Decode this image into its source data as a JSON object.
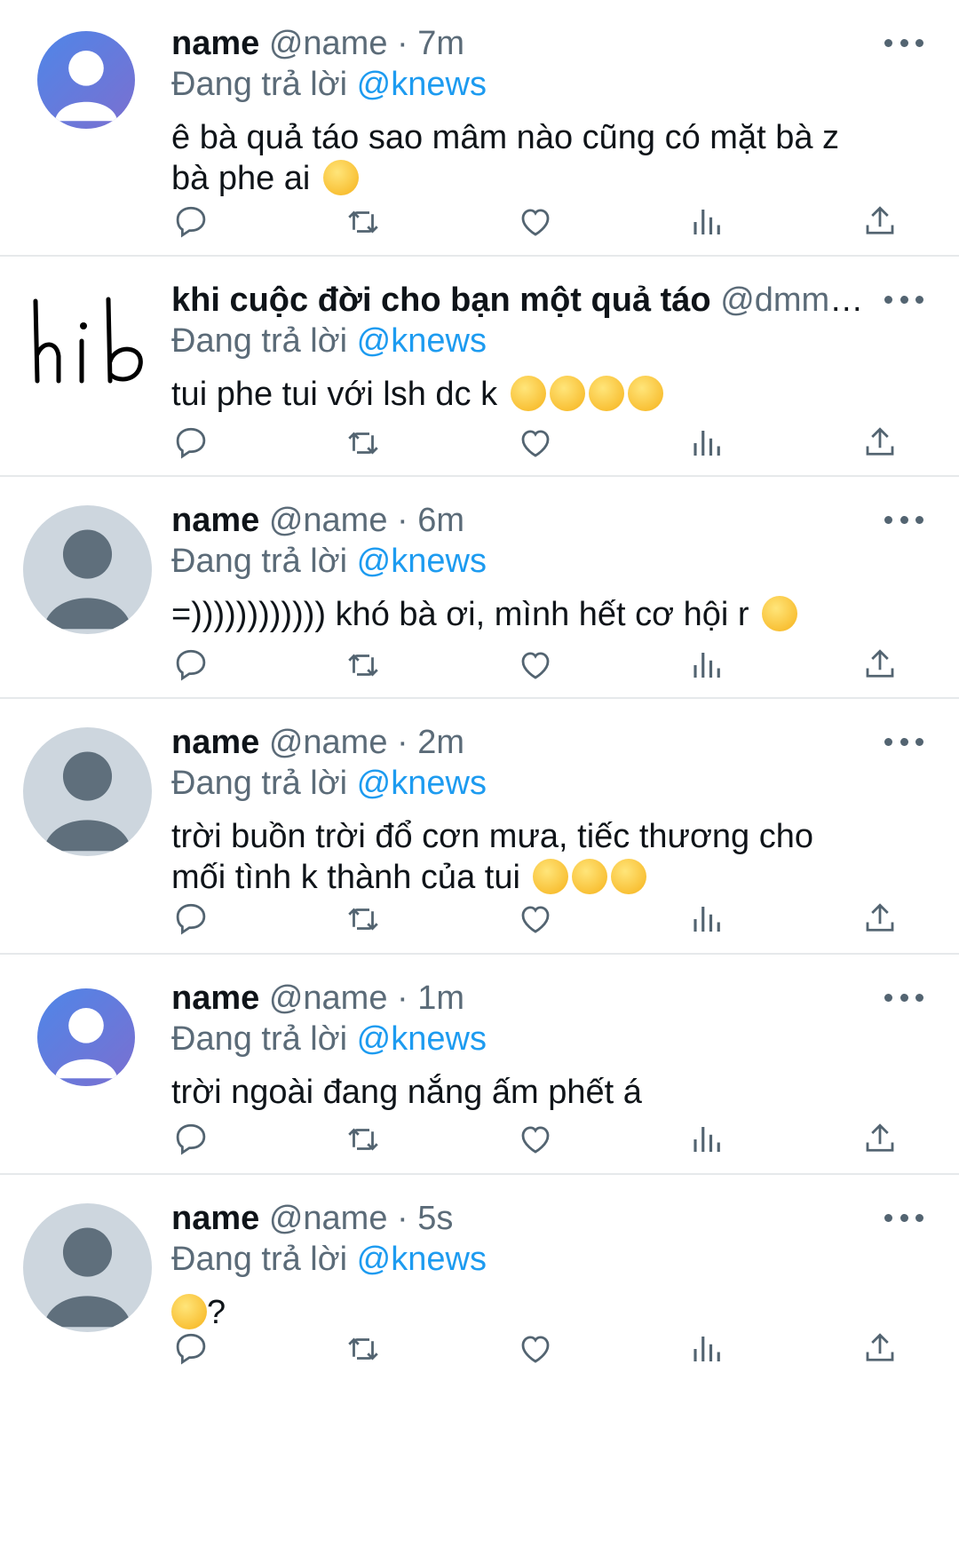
{
  "tweets": [
    {
      "avatar": "person-blue-gradient",
      "name": "name",
      "meta": "@name · 7m",
      "replying_prefix": "Đang trả lời",
      "replying_handle": "@knews",
      "text": "ê bà quả táo sao mâm nào cũng có mặt bà z bà phe ai",
      "emoji": [
        "angry-face"
      ]
    },
    {
      "avatar": "handwritten-hib",
      "avatar_text": "hib",
      "name": "khi cuộc đời cho bạn một quả táo",
      "meta": "@dmmmc...",
      "replying_prefix": "Đang trả lời",
      "replying_handle": "@knews",
      "text": "tui phe tui với lsh dc k",
      "emoji": [
        "loudly-crying-face",
        "loudly-crying-face",
        "loudly-crying-face",
        "loudly-crying-face"
      ]
    },
    {
      "avatar": "default-grey-person",
      "name": "name",
      "meta": "@name · 6m",
      "replying_prefix": "Đang trả lời",
      "replying_handle": "@knews",
      "text": "=)))))))))))) khó bà ơi, mình hết cơ hội r",
      "emoji": [
        "smiling-face"
      ]
    },
    {
      "avatar": "default-grey-person",
      "name": "name",
      "meta": "@name · 2m",
      "replying_prefix": "Đang trả lời",
      "replying_handle": "@knews",
      "text": "trời buồn trời đổ cơn mưa, tiếc thương cho mối tình k thành của tui",
      "emoji": [
        "pensive-face",
        "pensive-face",
        "pensive-face"
      ]
    },
    {
      "avatar": "person-blue-gradient",
      "name": "name",
      "meta": "@name · 1m",
      "replying_prefix": "Đang trả lời",
      "replying_handle": "@knews",
      "text": "trời ngoài đang nắng ấm phết á",
      "emoji": []
    },
    {
      "avatar": "default-grey-person",
      "name": "name",
      "meta": "@name · 5s",
      "replying_prefix": "Đang trả lời",
      "replying_handle": "@knews",
      "text": "",
      "emoji": [
        "smiling-face"
      ],
      "text_after": "?"
    }
  ],
  "colors": {
    "text": "#0f1419",
    "secondary": "#5b6b78",
    "mention": "#1d9bf0",
    "divider": "#e6e9eb",
    "icon": "#536471"
  },
  "actions": [
    "reply-icon",
    "retweet-icon",
    "like-icon",
    "analytics-icon",
    "share-icon"
  ]
}
